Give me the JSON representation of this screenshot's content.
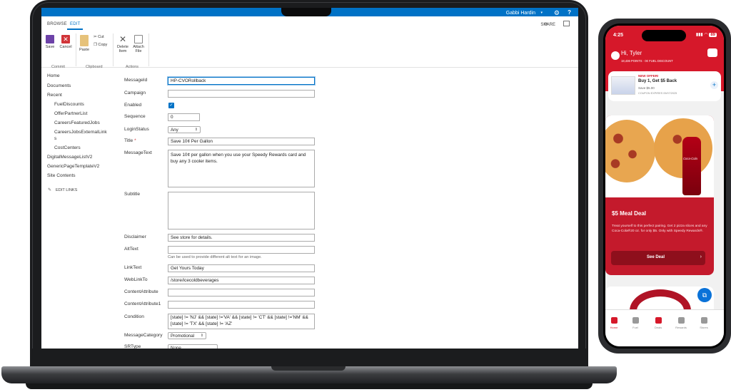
{
  "suite": {
    "user": "Gabbi Hardin",
    "share_label": "SHARE",
    "tabs": [
      "BROWSE",
      "EDIT"
    ]
  },
  "ribbon": {
    "commit": {
      "group": "Commit",
      "save": "Save",
      "cancel": "Cancel"
    },
    "clipboard": {
      "group": "Clipboard",
      "paste": "Paste",
      "cut": "Cut",
      "copy": "Copy"
    },
    "actions": {
      "group": "Actions",
      "delete": "Delete Item",
      "attach": "Attach File"
    }
  },
  "left_nav": {
    "items": [
      "Home",
      "Documents",
      "Recent"
    ],
    "recent": [
      "FuelDiscounts",
      "OfferPartnerList",
      "CareersFeaturedJobs",
      "CareersJobsExternalLink",
      "s",
      "CostCenters"
    ],
    "bottom": [
      "DigitalMessageListV2",
      "GenericPageTemplateV2",
      "Site Contents"
    ],
    "edit_links": "EDIT LINKS"
  },
  "form": {
    "labels": {
      "message_id": "MessageId",
      "campaign": "Campaign",
      "enabled": "Enabled",
      "sequence": "Sequence",
      "login_status": "LoginStatus",
      "title": "Title",
      "required": "*",
      "message_text": "MessageText",
      "subtitle": "Subtitle",
      "disclaimer": "Disclaimer",
      "alt_text": "AltText",
      "link_text": "LinkText",
      "web_link_to": "WebLinkTo",
      "content_attribute": "ContentAttribute",
      "content_attribute1": "ContentAttribute1",
      "condition": "Condition",
      "message_category": "MessageCategory",
      "sr_type": "SRType"
    },
    "values": {
      "message_id": "HP-CVORollback",
      "campaign": "",
      "sequence": "0",
      "login_status": "Any",
      "title": "Save 10¢ Per Gallon",
      "message_text": "Save 10¢ per gallon when you use your Speedy Rewards card and buy any 3 cooler items.",
      "subtitle": "",
      "disclaimer": "See store for details.",
      "alt_text": "",
      "alt_text_hint": "Can be used to provide different alt text for an image.",
      "link_text": "Get Yours Today",
      "web_link_to": "/store/icecoldbeverages",
      "content_attribute": "",
      "content_attribute1": "",
      "condition": "[state] != 'NJ' && [state] !='VA' && [state] != 'CT' && [state] !='NM' && [state] != 'TX' && [state] != 'AZ'",
      "message_category": "Promotional",
      "sr_type": "None"
    }
  },
  "phone": {
    "time": "4:25",
    "battery": "89",
    "greeting": "Hi, Tyler",
    "points_line": "18,436 POINTS · 0¢ FUEL DISCOUNT",
    "offer": {
      "badge": "NEW OFFER!",
      "title": "Buy 1, Get $5 Back",
      "save": "Save $5.00",
      "expires": "COUPON EXPIRES 05/07/2025"
    },
    "deal": {
      "title": "$5 Meal Deal",
      "body": "Treat yourself to this perfect pairing. Get 2 pizza slices and any Coca-Cola®20 oz. for only $5. Only with Speedy Rewards®.",
      "cta": "See Deal",
      "bottle_label": "Coca-Cola"
    },
    "nav": [
      "Home",
      "Fuel",
      "Deals",
      "Rewards",
      "Stores"
    ]
  },
  "colors": {
    "sp_blue": "#0072c6",
    "speedway_red": "#d6182a",
    "laptop": "#1b1c1e"
  }
}
